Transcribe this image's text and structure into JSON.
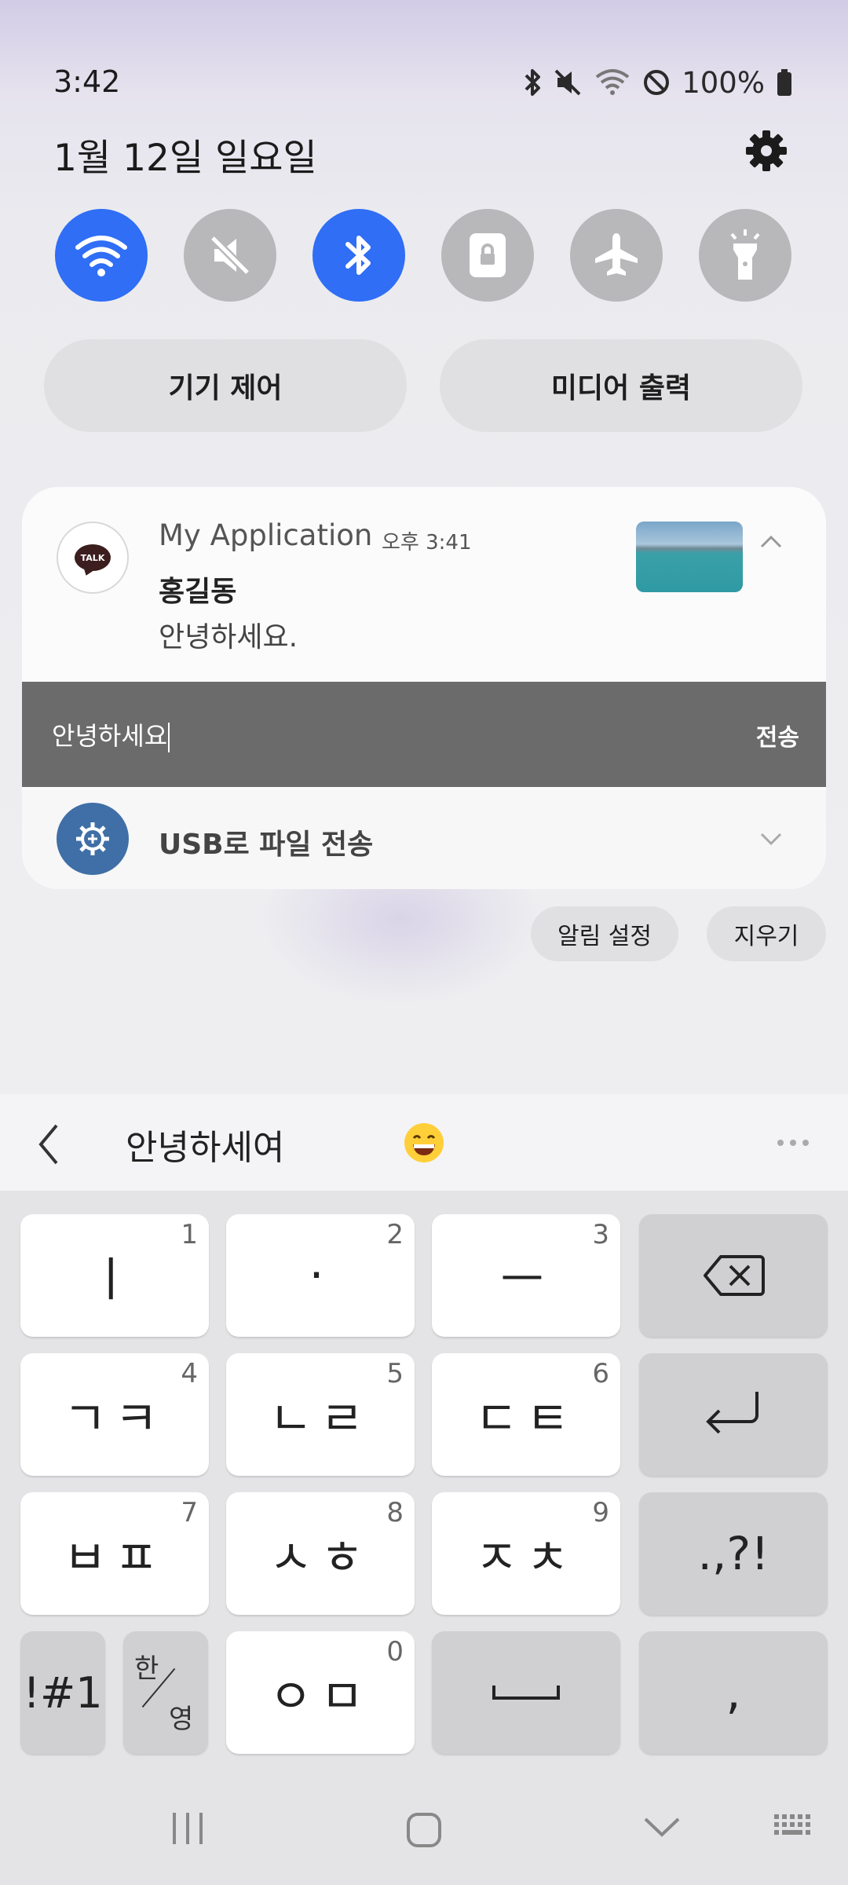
{
  "status_bar": {
    "time": "3:42",
    "battery": "100%",
    "icons": [
      "bluetooth-icon",
      "mute-icon",
      "wifi-icon",
      "no-disturb-icon",
      "battery-icon"
    ]
  },
  "panel": {
    "date": "1월 12일 일요일",
    "toggles": [
      {
        "name": "wifi",
        "on": true
      },
      {
        "name": "sound",
        "on": false
      },
      {
        "name": "bluetooth",
        "on": true
      },
      {
        "name": "portrait-lock",
        "on": false
      },
      {
        "name": "airplane",
        "on": false
      },
      {
        "name": "flashlight",
        "on": false
      }
    ],
    "device_control": "기기 제어",
    "media_output": "미디어 출력"
  },
  "notification": {
    "app_name": "My Application",
    "time": "오후 3:41",
    "sender": "홍길동",
    "message": "안녕하세요.",
    "reply_text": "안녕하세요",
    "send_label": "전송",
    "talk_logo": "TALK"
  },
  "usb": {
    "label": "USB로 파일 전송"
  },
  "actions": {
    "notification_settings": "알림 설정",
    "clear": "지우기"
  },
  "keyboard": {
    "suggestion": "안녕하세여",
    "keys": [
      {
        "label": "ㅣ",
        "num": "1"
      },
      {
        "label": "·",
        "num": "2"
      },
      {
        "label": "ㅡ",
        "num": "3"
      },
      {
        "label": "ㄱㅋ",
        "num": "4"
      },
      {
        "label": "ㄴㄹ",
        "num": "5"
      },
      {
        "label": "ㄷㅌ",
        "num": "6"
      },
      {
        "label": "ㅂㅍ",
        "num": "7"
      },
      {
        "label": "ㅅㅎ",
        "num": "8"
      },
      {
        "label": "ㅈㅊ",
        "num": "9"
      },
      {
        "label": "ㅇㅁ",
        "num": "0"
      }
    ],
    "symbols_key": "!#1",
    "lang_top": "한",
    "lang_bottom": "영",
    "punct_key": ".,?!",
    "comma_key": ","
  },
  "colors": {
    "accent": "#2f6ef5",
    "toggle_off": "#b8b8bb",
    "reply_bar": "#6b6b6b"
  }
}
